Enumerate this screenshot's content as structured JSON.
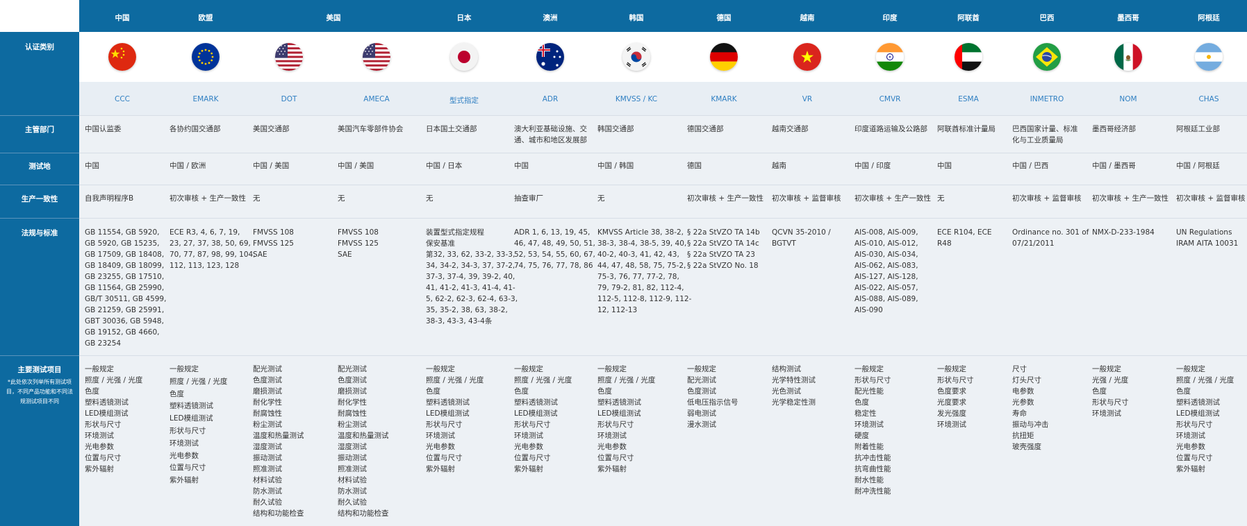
{
  "rows": {
    "cert_type": "认证类别",
    "authority": "主管部门",
    "test_site": "测试地",
    "conformity": "生产一致性",
    "regulation": "法规与标准",
    "tests": "主要测试项目",
    "tests_note": "*此处依次列举所有测试项目，不同产品功能和不同法规测试项目不同"
  },
  "countries": [
    {
      "name": "中国",
      "flag": "china-flag-icon",
      "cert": "CCC",
      "authority": "中国认监委",
      "site": "中国",
      "conformity": "自我声明程序B",
      "standards": "GB 11554, GB 5920,\nGB 5920, GB 15235,\nGB 17509, GB 18408,\nGB 18409, GB 18099,\nGB 23255, GB 17510,\nGB 11564, GB 25990,\nGB/T 30511, GB 4599,\nGB 21259, GB 25991,\nGBT 30036, GB 5948,\nGB 19152, GB 4660,\nGB 23254",
      "tests": "一般规定\n照度 / 光强 / 光度\n色度\n塑料透镜测试\nLED模组测试\n形状与尺寸\n环境测试\n光电参数\n位置与尺寸\n紫外辐射"
    },
    {
      "name": "欧盟",
      "flag": "eu-flag-icon",
      "cert": "EMARK",
      "authority": "各协约国交通部",
      "site": "中国 / 欧洲",
      "conformity": "初次审核 + 生产一致性",
      "standards": "ECE R3, 4, 6, 7, 19,\n23, 27, 37, 38, 50, 69,\n70, 77, 87, 98, 99, 104,\n112, 113, 123, 128",
      "tests": "一般规定\n照度 / 光强 / 光度\n色度\n塑料透镜测试\nLED模组测试\n形状与尺寸\n环境测试\n光电参数\n位置与尺寸\n紫外辐射"
    },
    {
      "name": "美国",
      "flag": "usa-flag-icon",
      "cert": "DOT",
      "authority": "美国交通部",
      "site": "中国 / 美国",
      "conformity": "无",
      "standards": "FMVSS 108\nFMVSS 125\nSAE",
      "tests": "配光测试\n色度测试\n磨损测试\n耐化学性\n耐腐蚀性\n粉尘测试\n温度和热量测试\n湿度测试\n振动测试\n照准测试\n材料试验\n防水测试\n耐久试验\n结构和功能检查"
    },
    {
      "name": "",
      "flag": "usa-flag-icon",
      "cert": "AMECA",
      "authority": "美国汽车零部件协会",
      "site": "中国 / 美国",
      "conformity": "无",
      "standards": "FMVSS 108\nFMVSS 125\nSAE",
      "tests": "配光测试\n色度测试\n磨损测试\n耐化学性\n耐腐蚀性\n粉尘测试\n温度和热量测试\n湿度测试\n振动测试\n照准测试\n材料试验\n防水测试\n耐久试验\n结构和功能检查"
    },
    {
      "name": "日本",
      "flag": "japan-flag-icon",
      "cert": "型式指定",
      "authority": "日本国土交通部",
      "site": "中国 / 日本",
      "conformity": "无",
      "standards": "装置型式指定规程\n保安基准\n第32, 33, 62, 33-2, 33-3,\n34, 34-2, 34-3, 37, 37-2,\n37-3, 37-4, 39, 39-2, 40,\n41, 41-2, 41-3, 41-4, 41-\n5, 62-2, 62-3, 62-4, 63-3,\n35, 35-2, 38, 63, 38-2,\n38-3, 43-3, 43-4条",
      "tests": "一般规定\n照度 / 光强 / 光度\n色度\n塑料透镜测试\nLED模组测试\n形状与尺寸\n环境测试\n光电参数\n位置与尺寸\n紫外辐射"
    },
    {
      "name": "澳洲",
      "flag": "australia-flag-icon",
      "cert": "ADR",
      "authority": "澳大利亚基础设施、交\n通、城市和地区发展部",
      "site": "中国",
      "conformity": "抽查审厂",
      "standards": "ADR 1, 6, 13, 19, 45,\n46, 47, 48, 49, 50, 51,\n52, 53, 54, 55, 60, 67,\n74, 75, 76, 77, 78, 86",
      "tests": "一般规定\n照度 / 光强 / 光度\n色度\n塑料透镜测试\nLED模组测试\n形状与尺寸\n环境测试\n光电参数\n位置与尺寸\n紫外辐射"
    },
    {
      "name": "韩国",
      "flag": "korea-flag-icon",
      "cert": "KMVSS / KC",
      "authority": "韩国交通部",
      "site": "中国 / 韩国",
      "conformity": "无",
      "standards": "KMVSS Article 38, 38-2,\n38-3, 38-4, 38-5, 39, 40,\n40-2, 40-3, 41, 42, 43,\n44, 47, 48, 58, 75, 75-2,\n75-3, 76, 77, 77-2, 78,\n79, 79-2, 81, 82, 112-4,\n112-5, 112-8, 112-9, 112-\n12, 112-13",
      "tests": "一般规定\n照度 / 光强 / 光度\n色度\n塑料透镜测试\nLED模组测试\n形状与尺寸\n环境测试\n光电参数\n位置与尺寸\n紫外辐射"
    },
    {
      "name": "德国",
      "flag": "germany-flag-icon",
      "cert": "KMARK",
      "authority": "德国交通部",
      "site": "德国",
      "conformity": "初次审核 + 生产一致性",
      "standards": "§ 22a StVZO TA 14b\n§ 22a StVZO TA 14c\n§ 22a StVZO TA 23\n§ 22a StVZO No. 18",
      "tests": "一般规定\n配光测试\n色度测试\n低电压指示信号\n弱电测试\n漫水测试"
    },
    {
      "name": "越南",
      "flag": "vietnam-flag-icon",
      "cert": "VR",
      "authority": "越南交通部",
      "site": "越南",
      "conformity": "初次审核 + 监督审核",
      "standards": "QCVN 35-2010 /\nBGTVT",
      "tests": "结构测试\n光学特性测试\n 光色测试\n光学稳定性测"
    },
    {
      "name": "印度",
      "flag": "india-flag-icon",
      "cert": "CMVR",
      "authority": "印度道路运输及公路部",
      "site": "中国 / 印度",
      "conformity": "初次审核 + 生产一致性",
      "standards": "AIS-008, AIS-009,\nAIS-010, AIS-012,\nAIS-030, AIS-034,\nAIS-062, AIS-083,\nAIS-127, AIS-128,\nAIS-022, AIS-057,\nAIS-088, AIS-089,\nAIS-090",
      "tests": "一般规定\n形状与尺寸\n配光性能\n色度\n稳定性\n环境测试\n硬度\n附着性能\n抗冲击性能\n抗弯曲性能\n耐水性能\n耐冲洗性能"
    },
    {
      "name": "阿联酋",
      "flag": "uae-flag-icon",
      "cert": "ESMA",
      "authority": "阿联酋标准计量局",
      "site": "中国",
      "conformity": "无",
      "standards": "ECE R104, ECE\nR48",
      "tests": "一般规定\n形状与尺寸\n色度要求\n光度要求\n发光强度\n环境测试"
    },
    {
      "name": "巴西",
      "flag": "brazil-flag-icon",
      "cert": "INMETRO",
      "authority": "巴西国家计量、标准\n化与工业质量局",
      "site": "中国 / 巴西",
      "conformity": "初次审核 + 监督审核",
      "standards": "Ordinance no. 301 of\n07/21/2011",
      "tests": "尺寸\n灯头尺寸\n电参数\n光参数\n寿命\n振动与冲击\n抗扭矩\n玻壳强度"
    },
    {
      "name": "墨西哥",
      "flag": "mexico-flag-icon",
      "cert": "NOM",
      "authority": "墨西哥经济部",
      "site": "中国 / 墨西哥",
      "conformity": "初次审核 + 生产一致性",
      "standards": "NMX-D-233-1984",
      "tests": "一般规定\n光强 / 光度\n色度\n形状与尺寸\n环境测试"
    },
    {
      "name": "阿根廷",
      "flag": "argentina-flag-icon",
      "cert": "CHAS",
      "authority": "阿根廷工业部",
      "site": "中国 / 阿根廷",
      "conformity": "初次审核 + 监督审核",
      "standards": "UN Regulations\nIRAM AITA 10031",
      "tests": "一般规定\n照度 / 光强 / 光度\n色度\n塑料透镜测试\nLED模组测试\n形状与尺寸\n环境测试\n光电参数\n位置与尺寸\n紫外辐射"
    }
  ],
  "colors": {
    "primary": "#0d6aa0",
    "link": "#2f7fc2",
    "band": "#e8eef4"
  }
}
